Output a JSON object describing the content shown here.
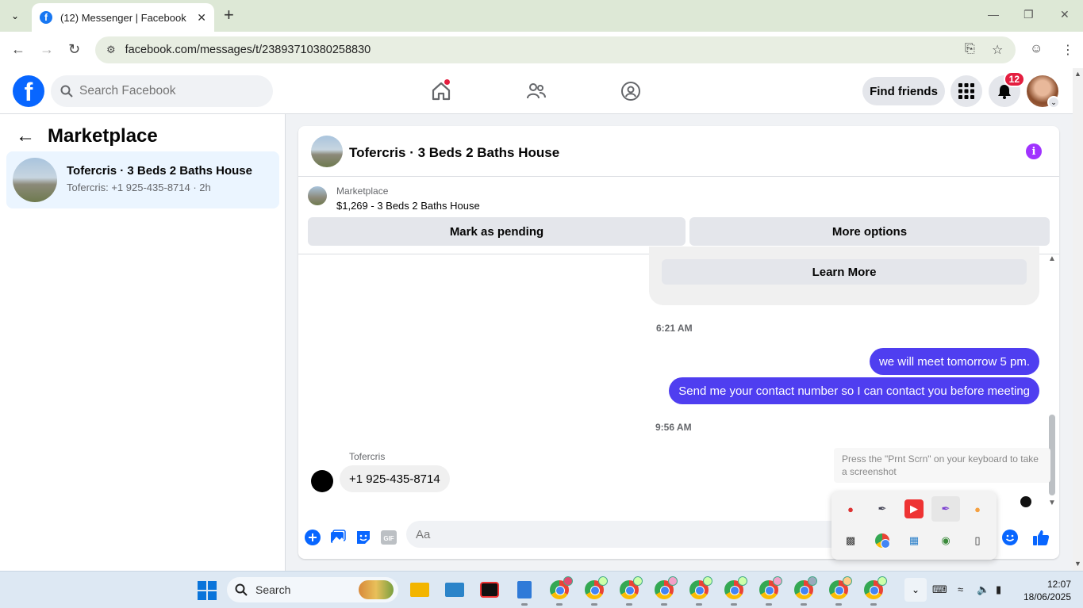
{
  "browser": {
    "tab_title": "(12) Messenger | Facebook",
    "url": "facebook.com/messages/t/23893710380258830"
  },
  "fb": {
    "search_placeholder": "Search Facebook",
    "find_friends": "Find friends",
    "notif_count": "12"
  },
  "left": {
    "title": "Marketplace",
    "conversation": {
      "name": "Tofercris · 3 Beds 2 Baths House",
      "preview": "Tofercris: +1 925-435-8714 · 2h"
    }
  },
  "chat": {
    "title": "Tofercris · 3 Beds 2 Baths House",
    "marketplace_label": "Marketplace",
    "listing": "$1,269 - 3 Beds 2 Baths House",
    "mark_pending": "Mark as pending",
    "more_options": "More options",
    "learn_more": "Learn More",
    "time1": "6:21 AM",
    "msg1": "we will meet tomorrow 5 pm.",
    "msg2": "Send me your contact number so I can contact you before meeting",
    "time2": "9:56 AM",
    "sender": "Tofercris",
    "reply": "+1 925-435-8714",
    "composer_placeholder": "Aa"
  },
  "overlay": {
    "tip": "Press the \"Prnt Scrn\" on your keyboard to take a screenshot"
  },
  "taskbar": {
    "search_label": "Search",
    "time": "12:07",
    "date": "18/06/2025"
  },
  "colors": {
    "fb_blue": "#0866ff",
    "outgoing_bubble": "#4f3ef0",
    "notif_red": "#e41e3f"
  }
}
